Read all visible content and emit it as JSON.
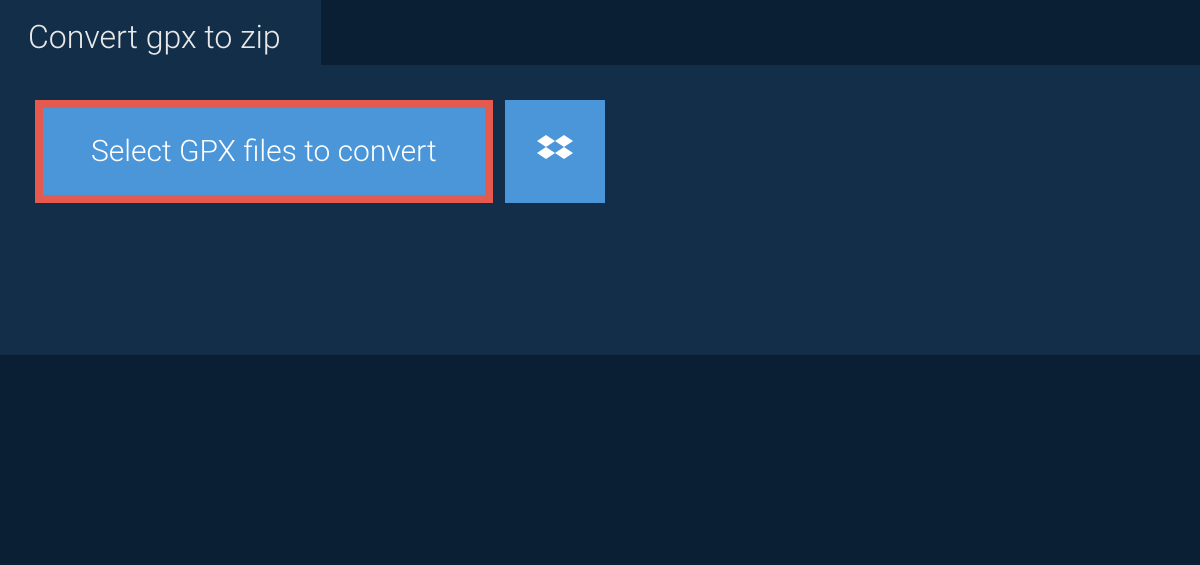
{
  "tab": {
    "title": "Convert gpx to zip"
  },
  "actions": {
    "select_label": "Select GPX files to convert"
  }
}
